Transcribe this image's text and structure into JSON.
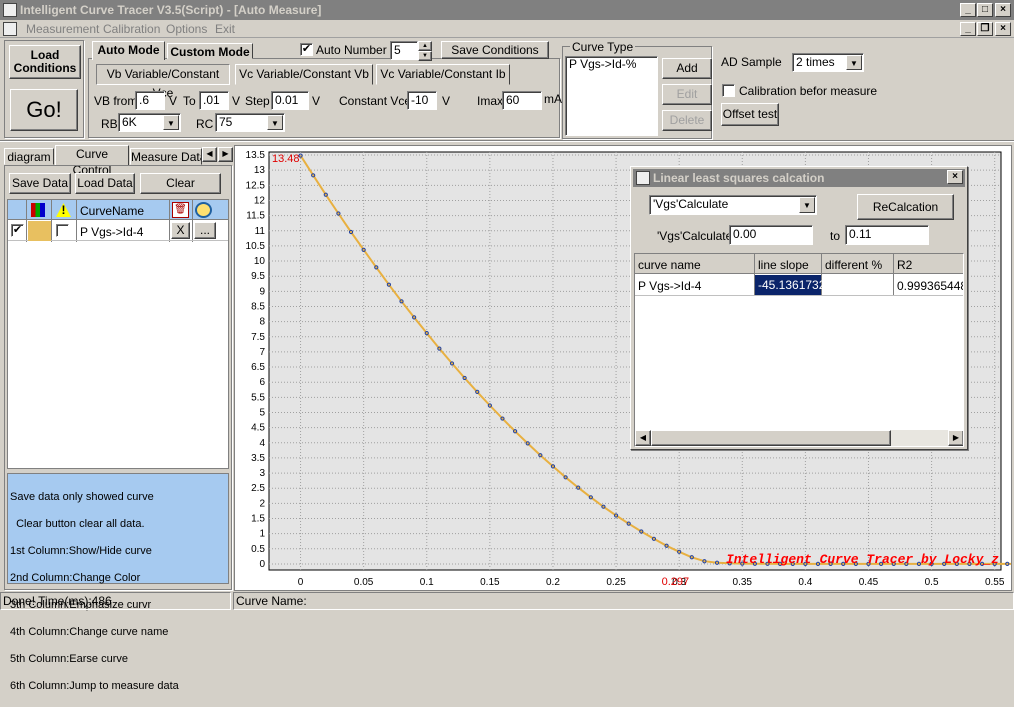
{
  "window": {
    "title": "Intelligent Curve Tracer V3.5(Script) - [Auto Measure]"
  },
  "menu": [
    "Measurement",
    "Calibration",
    "Options",
    "Exit"
  ],
  "toolbar": {
    "load_conditions": "Load Conditions",
    "go": "Go!",
    "tab_auto": "Auto Mode",
    "tab_custom": "Custom Mode",
    "auto_number_label": "Auto Number",
    "auto_number_value": "5",
    "auto_number_checked": true,
    "save_conditions": "Save Conditions",
    "subtabs": [
      "Vb Variable/Constant Vce",
      "Vc Variable/Constant Vb",
      "Vc Variable/Constant Ib"
    ],
    "vb_from_label": "VB from",
    "vb_from": ".6",
    "v1": "V",
    "to_label": "To",
    "to": ".01",
    "v2": "V",
    "step_label": "Step",
    "step": "0.01",
    "v3": "V",
    "constant_vce_label": "Constant Vce",
    "constant_vce": "-10",
    "v4": "V",
    "imax_label": "Imax",
    "imax": "60",
    "ma": "mA",
    "rb_label": "RB",
    "rb": "6K",
    "rc_label": "RC",
    "rc": "75",
    "curve_type_title": "Curve Type",
    "curve_type_item": "P Vgs->Id-%",
    "add": "Add",
    "edit": "Edit",
    "delete": "Delete",
    "ad_sample_label": "AD Sample",
    "ad_sample": "2 times",
    "calibration_label": "Calibration befor measure",
    "offset_test": "Offset test"
  },
  "left_panel": {
    "tabs": [
      "diagram",
      "Curve Control",
      "Measure Data"
    ],
    "save_data": "Save Data",
    "load_data": "Load Data",
    "clear": "Clear",
    "col_curvename": "CurveName",
    "row": {
      "name": "P Vgs->Id-4",
      "x": "X",
      "more": "...",
      "color": "#e8c060"
    },
    "help": [
      "Save data only showed curve",
      "  Clear button clear all data.",
      "1st Column:Show/Hide curve",
      "2nd Column:Change Color",
      "3th Column:Emphasize curvr",
      "4th Column:Change curve name",
      "5th Column:Earse curve",
      "6th Column:Jump to measure data"
    ]
  },
  "status": {
    "left": "Done!  Time(ms):486",
    "right": "Curve Name:"
  },
  "dialog": {
    "title": "Linear least squares calcation",
    "select": "'Vgs'Calculate",
    "recalc": "ReCalcation",
    "range_label": "'Vgs'Calculate",
    "from": "0.00",
    "to_label": "to",
    "to": "0.11",
    "headers": [
      "curve name",
      "line slope",
      "different %",
      "R2"
    ],
    "row": [
      "P Vgs->Id-4",
      "-45.1361732",
      "",
      "0.9993654489"
    ]
  },
  "chart_data": {
    "type": "line",
    "x": [
      0,
      0.01,
      0.02,
      0.03,
      0.04,
      0.05,
      0.06,
      0.07,
      0.08,
      0.09,
      0.1,
      0.11,
      0.12,
      0.13,
      0.14,
      0.15,
      0.16,
      0.17,
      0.18,
      0.19,
      0.2,
      0.21,
      0.22,
      0.23,
      0.24,
      0.25,
      0.26,
      0.27,
      0.28,
      0.29,
      0.3,
      0.31,
      0.32,
      0.33,
      0.34,
      0.35,
      0.36,
      0.37,
      0.38,
      0.39,
      0.4,
      0.41,
      0.42,
      0.43,
      0.44,
      0.45,
      0.46,
      0.47,
      0.48,
      0.49,
      0.5,
      0.51,
      0.52,
      0.53,
      0.54,
      0.55,
      0.56,
      0.57,
      0.58,
      0.59,
      0.6
    ],
    "y": [
      13.48,
      12.83,
      12.19,
      11.57,
      10.96,
      10.37,
      9.79,
      9.22,
      8.67,
      8.14,
      7.62,
      7.11,
      6.62,
      6.14,
      5.68,
      5.23,
      4.8,
      4.38,
      3.98,
      3.59,
      3.22,
      2.86,
      2.52,
      2.2,
      1.89,
      1.6,
      1.33,
      1.07,
      0.83,
      0.6,
      0.4,
      0.22,
      0.09,
      0.04,
      0.02,
      0.01,
      0.005,
      0.004,
      0.003,
      0.003,
      0.002,
      0.002,
      0.002,
      0.002,
      0.002,
      0.002,
      0.002,
      0.002,
      0.002,
      0.002,
      0.002,
      0.002,
      0.002,
      0.002,
      0.002,
      0.002,
      0.002,
      0.002,
      0.002,
      0.002,
      0.002
    ],
    "xlim": [
      -0.025,
      0.555
    ],
    "ylim": [
      -0.2,
      13.6
    ],
    "xticks": [
      "0",
      "0.05",
      "0.1",
      "0.15",
      "0.2",
      "0.25",
      "0.3",
      "0.35",
      "0.4",
      "0.45",
      "0.5",
      "0.55"
    ],
    "xtick_values": [
      0,
      0.05,
      0.1,
      0.15,
      0.2,
      0.25,
      0.3,
      0.35,
      0.4,
      0.45,
      0.5,
      0.55
    ],
    "ytick_values": [
      0,
      0.5,
      1,
      1.5,
      2,
      2.5,
      3,
      3.5,
      4,
      4.5,
      5,
      5.5,
      6,
      6.5,
      7,
      7.5,
      8,
      8.5,
      9,
      9.5,
      10,
      10.5,
      11,
      11.5,
      12,
      12.5,
      13,
      13.5
    ],
    "yticks": [
      "0",
      "0.5",
      "1",
      "1.5",
      "2",
      "2.5",
      "3",
      "3.5",
      "4",
      "4.5",
      "5",
      "5.5",
      "6",
      "6.5",
      "7",
      "7.5",
      "8",
      "8.5",
      "9",
      "9.5",
      "10",
      "10.5",
      "11",
      "11.5",
      "12",
      "12.5",
      "13",
      "13.5"
    ],
    "ymax_label": "13.48",
    "xcross_label": "0.297",
    "watermark": "Intelligent Curve Tracer by Locky_z",
    "grid": true,
    "line_color": "#e8b040",
    "marker_color": "#2040a0"
  }
}
